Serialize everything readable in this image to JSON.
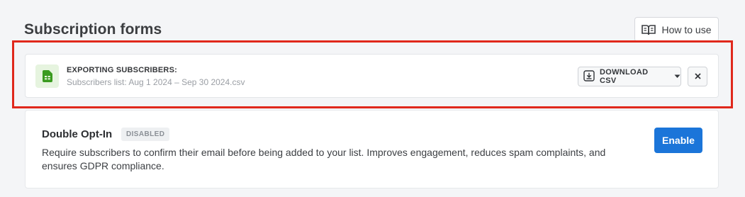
{
  "header": {
    "title": "Subscription forms",
    "how_to_use_label": "How to use",
    "how_to_use_icon": "book-open-icon"
  },
  "export": {
    "title": "EXPORTING SUBSCRIBERS:",
    "subtitle": "Subscribers list: Aug 1 2024 – Sep 30 2024.csv",
    "file_icon": "spreadsheet-file-icon",
    "download_label": "DOWNLOAD CSV",
    "download_icon": "download-icon",
    "dropdown_icon": "caret-down-icon",
    "close_icon": "close-icon",
    "highlight_color": "#e0281c",
    "file_icon_color": "#3a9b1f"
  },
  "double_opt_in": {
    "title": "Double Opt-In",
    "status": "DISABLED",
    "description": "Require subscribers to confirm their email before being added to your list. Improves engagement, reduces spam complaints, and ensures GDPR compliance.",
    "enable_label": "Enable",
    "accent_color": "#1b75d9"
  }
}
